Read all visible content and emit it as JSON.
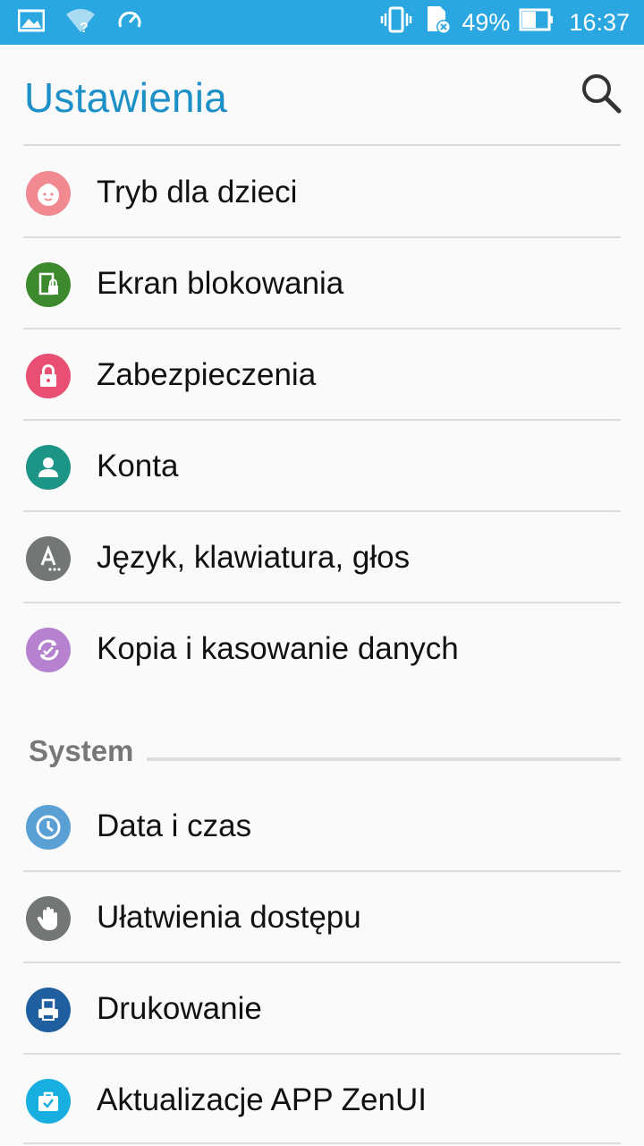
{
  "status_bar": {
    "battery_percent": "49%",
    "time": "16:37",
    "icons": [
      "gallery-icon",
      "wifi-unknown-icon",
      "speed-icon",
      "vibrate-icon",
      "sd-card-removed-icon",
      "battery-icon"
    ]
  },
  "header": {
    "title": "Ustawienia",
    "search_icon": "search-icon"
  },
  "items": [
    {
      "label": "Tryb dla dzieci",
      "icon": "kid-face-icon",
      "color": "#f08a90"
    },
    {
      "label": "Ekran blokowania",
      "icon": "lock-screen-icon",
      "color": "#3d8a2e"
    },
    {
      "label": "Zabezpieczenia",
      "icon": "padlock-icon",
      "color": "#e84f72"
    },
    {
      "label": "Konta",
      "icon": "person-icon",
      "color": "#1c9587"
    },
    {
      "label": "Język, klawiatura, głos",
      "icon": "language-icon",
      "color": "#727775"
    },
    {
      "label": "Kopia i kasowanie danych",
      "icon": "backup-icon",
      "color": "#b682cf"
    }
  ],
  "system_section": {
    "title": "System",
    "items": [
      {
        "label": "Data i czas",
        "icon": "clock-icon",
        "color": "#5aa0d4"
      },
      {
        "label": "Ułatwienia dostępu",
        "icon": "hand-icon",
        "color": "#727775"
      },
      {
        "label": "Drukowanie",
        "icon": "printer-icon",
        "color": "#1f5fa0"
      },
      {
        "label": "Aktualizacje APP ZenUI",
        "icon": "update-bag-icon",
        "color": "#18aee0"
      }
    ]
  }
}
